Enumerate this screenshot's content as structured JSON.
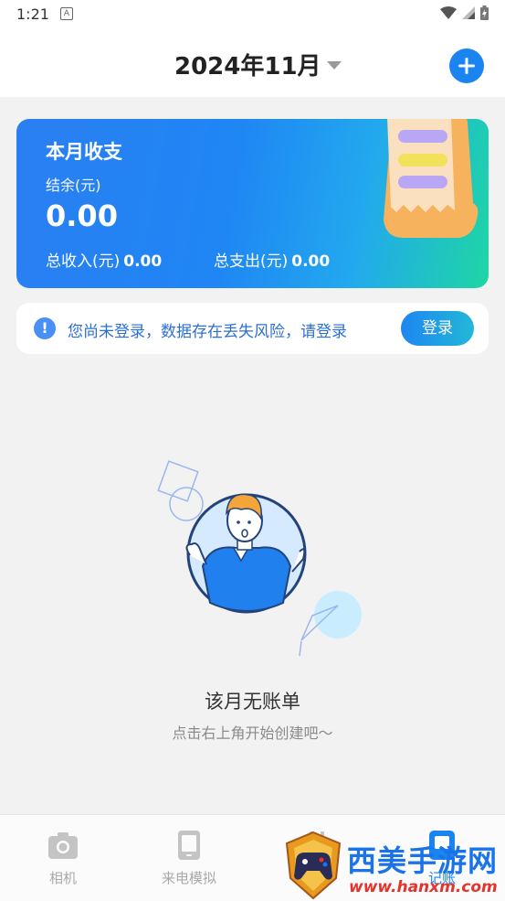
{
  "status_bar": {
    "time": "1:21",
    "notif_badge": "A"
  },
  "header": {
    "month": "2024年11月"
  },
  "summary_card": {
    "title": "本月收支",
    "balance_label": "结余(元)",
    "balance_value": "0.00",
    "income_label": "总收入(元)",
    "income_value": "0.00",
    "expense_label": "总支出(元)",
    "expense_value": "0.00"
  },
  "login_notice": {
    "text": "您尚未登录，数据存在丢失风险，请登录",
    "button": "登录"
  },
  "empty_state": {
    "title": "该月无账单",
    "subtitle": "点击右上角开始创建吧～"
  },
  "bottom_nav": [
    {
      "label": "相机",
      "icon": "camera-icon"
    },
    {
      "label": "来电模拟",
      "icon": "phone-icon"
    },
    {
      "label": "",
      "icon": "gift-icon"
    },
    {
      "label": "记账",
      "icon": "ledger-icon"
    }
  ],
  "watermark": {
    "text": "西美手游网",
    "url": "www.hanxm.com"
  },
  "colors": {
    "accent": "#1a85f0",
    "text_primary": "#222222",
    "text_secondary": "#8a8a8a",
    "notice_text": "#2b6fd6"
  }
}
